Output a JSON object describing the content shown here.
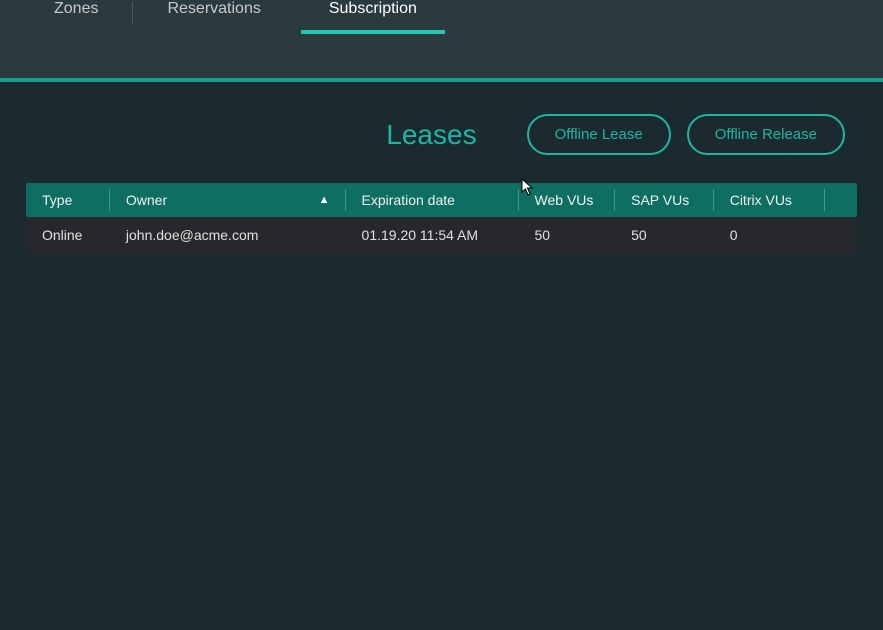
{
  "tabs": {
    "zones": "Zones",
    "reservations": "Reservations",
    "subscription": "Subscription"
  },
  "section": {
    "title": "Leases"
  },
  "buttons": {
    "offline_lease": "Offline Lease",
    "offline_release": "Offline Release"
  },
  "table": {
    "headers": {
      "type": "Type",
      "owner": "Owner",
      "expiration": "Expiration date",
      "web": "Web VUs",
      "sap": "SAP VUs",
      "citrix": "Citrix VUs"
    },
    "rows": [
      {
        "type": "Online",
        "owner": "john.doe@acme.com",
        "expiration": "01.19.20 11:54 AM",
        "web": "50",
        "sap": "50",
        "citrix": "0"
      }
    ]
  }
}
